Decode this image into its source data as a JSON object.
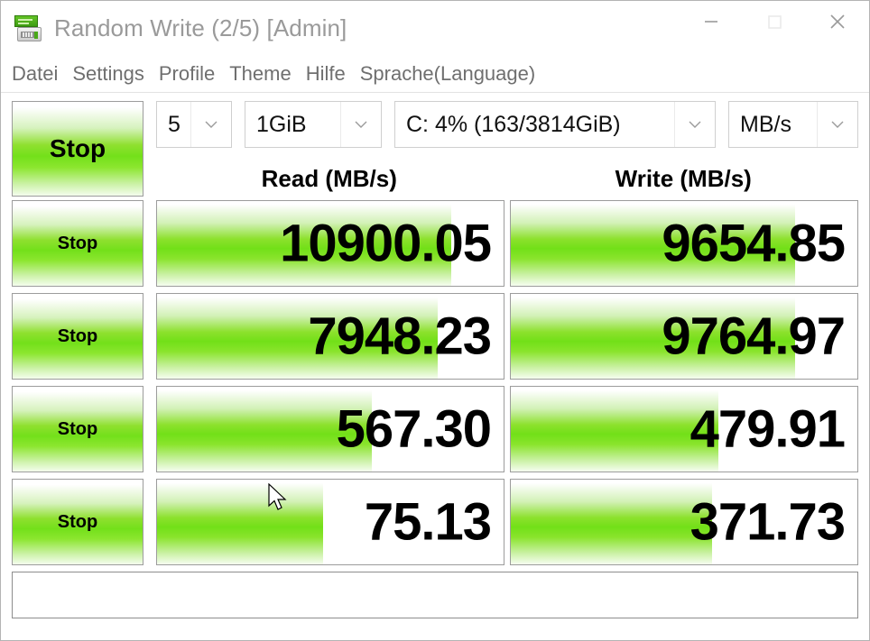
{
  "window": {
    "title": "Random Write (2/5) [Admin]",
    "icon": "crystaldiskmark-icon",
    "controls": {
      "minimize": "minimize-icon",
      "maximize": "maximize-icon",
      "close": "close-icon"
    }
  },
  "menubar": {
    "items": [
      {
        "label": "Datei"
      },
      {
        "label": "Settings"
      },
      {
        "label": "Profile"
      },
      {
        "label": "Theme"
      },
      {
        "label": "Hilfe"
      },
      {
        "label": "Sprache(Language)"
      }
    ]
  },
  "toolbar": {
    "main_button": "Stop",
    "count": {
      "value": "5",
      "arrow": "chevron-down-icon"
    },
    "size": {
      "value": "1GiB",
      "arrow": "chevron-down-icon"
    },
    "drive": {
      "value": "C: 4% (163/3814GiB)",
      "arrow": "chevron-down-icon"
    },
    "unit": {
      "value": "MB/s",
      "arrow": "chevron-down-icon"
    }
  },
  "columns": {
    "read": "Read (MB/s)",
    "write": "Write (MB/s)"
  },
  "rows": [
    {
      "button": "Stop",
      "read": {
        "value": "10900.05",
        "fill_percent": 85
      },
      "write": {
        "value": "9654.85",
        "fill_percent": 82
      }
    },
    {
      "button": "Stop",
      "read": {
        "value": "7948.23",
        "fill_percent": 81
      },
      "write": {
        "value": "9764.97",
        "fill_percent": 82
      }
    },
    {
      "button": "Stop",
      "read": {
        "value": "567.30",
        "fill_percent": 62
      },
      "write": {
        "value": "479.91",
        "fill_percent": 60
      }
    },
    {
      "button": "Stop",
      "read": {
        "value": "75.13",
        "fill_percent": 48
      },
      "write": {
        "value": "371.73",
        "fill_percent": 58
      }
    }
  ],
  "comment": {
    "value": ""
  },
  "colors": {
    "accent_green": "#72e018",
    "title_text": "#9a9a9a",
    "menu_text": "#6f6f6f",
    "border": "#9c9c9c"
  }
}
